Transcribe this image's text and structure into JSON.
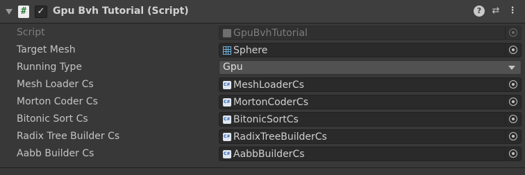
{
  "header": {
    "title": "Gpu Bvh Tutorial (Script)",
    "script_icon_glyph": "#",
    "enabled_check": "✓",
    "icons": {
      "help": "?",
      "presets": "⇄",
      "menu": "⋮"
    }
  },
  "properties": [
    {
      "label": "Script",
      "value": "GpuBvhTutorial",
      "icon": "script-file-icon",
      "disabled": true
    },
    {
      "label": "Target Mesh",
      "value": "Sphere",
      "icon": "mesh-icon"
    },
    {
      "label": "Running Type",
      "value": "Gpu",
      "type": "dropdown"
    },
    {
      "label": "Mesh Loader Cs",
      "value": "MeshLoaderCs",
      "icon": "compute-shader-icon"
    },
    {
      "label": "Morton Coder Cs",
      "value": "MortonCoderCs",
      "icon": "compute-shader-icon"
    },
    {
      "label": "Bitonic Sort Cs",
      "value": "BitonicSortCs",
      "icon": "compute-shader-icon"
    },
    {
      "label": "Radix Tree Builder Cs",
      "value": "RadixTreeBuilderCs",
      "icon": "compute-shader-icon"
    },
    {
      "label": "Aabb Builder Cs",
      "value": "AabbBuilderCs",
      "icon": "compute-shader-icon"
    }
  ]
}
